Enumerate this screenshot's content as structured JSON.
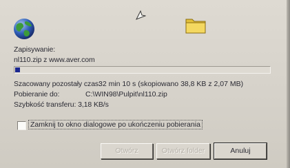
{
  "dialog": {
    "label_saving": "Zapisywanie:",
    "file_info": "nl110.zip z www.aver.com",
    "progress": 0.02,
    "estimated_label": "Szacowany pozostały czas:",
    "estimated_value": "32 min 10 s (skopiowano 38,8 KB z 2,07 MB)",
    "download_to_label": "Pobieranie do:",
    "download_to_value": "C:\\WIN98\\Pulpit\\nl110.zip",
    "transfer_rate": "Szybkość transferu: 3,18 KB/s",
    "close_on_complete_label": "Zamknij to okno dialogowe po ukończeniu pobierania",
    "close_on_complete_checked": false
  },
  "buttons": {
    "open": "Otwórz",
    "open_folder": "Otwórz folder",
    "cancel": "Anuluj"
  },
  "icons": {
    "globe": "globe-icon",
    "folder": "folder-icon",
    "cursor": "mouse-cursor-icon"
  }
}
